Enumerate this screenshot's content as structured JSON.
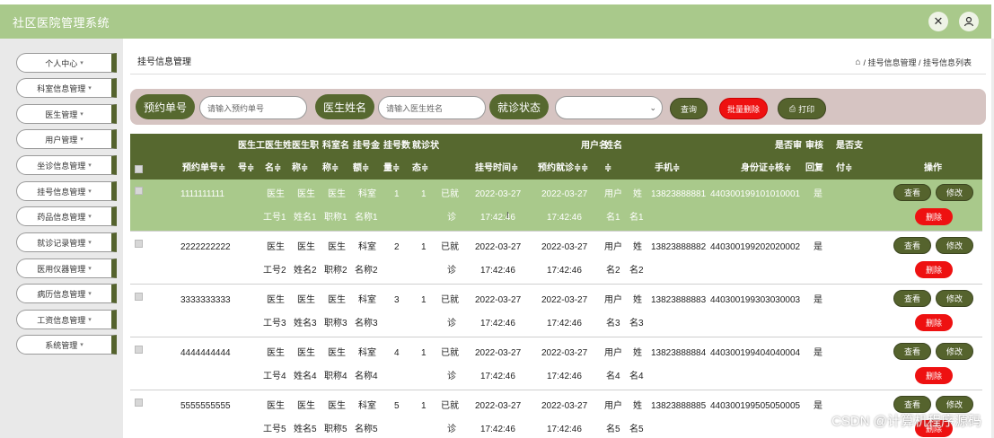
{
  "app": {
    "title": "社区医院管理系统"
  },
  "top_icons": [
    "fullscreen-icon",
    "user-icon"
  ],
  "sidebar": {
    "items": [
      {
        "label": "个人中心"
      },
      {
        "label": "科室信息管理"
      },
      {
        "label": "医生管理"
      },
      {
        "label": "用户管理"
      },
      {
        "label": "坐诊信息管理"
      },
      {
        "label": "挂号信息管理"
      },
      {
        "label": "药品信息管理"
      },
      {
        "label": "就诊记录管理"
      },
      {
        "label": "医用仪器管理"
      },
      {
        "label": "病历信息管理"
      },
      {
        "label": "工资信息管理"
      },
      {
        "label": "系统管理"
      }
    ]
  },
  "header": {
    "title": "挂号信息管理",
    "breadcrumb": "/ 挂号信息管理 / 挂号信息列表"
  },
  "search": {
    "reservation_label": "预约单号",
    "reservation_placeholder": "请输入预约单号",
    "doctor_label": "医生姓名",
    "doctor_placeholder": "请输入医生姓名",
    "status_label": "就诊状态",
    "status_value": "",
    "query_button": "查询",
    "batch_delete_button": "批量删除",
    "print_button": "打印"
  },
  "table": {
    "columns": [
      {
        "l1": "",
        "l2": "预约单号≑"
      },
      {
        "l1": "医生工",
        "l2": "号≑"
      },
      {
        "l1": "医生姓",
        "l2": "名≑"
      },
      {
        "l1": "医生职",
        "l2": "称≑"
      },
      {
        "l1": "科室名",
        "l2": "称≑"
      },
      {
        "l1": "挂号金",
        "l2": "额≑"
      },
      {
        "l1": "挂号数",
        "l2": "量≑"
      },
      {
        "l1": "就诊状",
        "l2": "态≑"
      },
      {
        "l1": "",
        "l2": "挂号时间≑"
      },
      {
        "l1": "",
        "l2": "预约就诊≑"
      },
      {
        "l1": "用户名",
        "l2": "≑"
      },
      {
        "l1": "姓名",
        "l2": "≑"
      },
      {
        "l1": "",
        "l2": "手机≑"
      },
      {
        "l1": "",
        "l2": "身份证≑"
      },
      {
        "l1": "是否审",
        "l2": "核≑"
      },
      {
        "l1": "审核",
        "l2": "回复"
      },
      {
        "l1": "是否支",
        "l2": "付≑"
      },
      {
        "l1": "",
        "l2": "操作"
      }
    ],
    "actions": {
      "view": "查看",
      "edit": "修改",
      "delete": "删除"
    },
    "rows": [
      {
        "id": "1111111111",
        "doc_no": [
          "医生",
          "工号1"
        ],
        "doc_name": [
          "医生",
          "姓名1"
        ],
        "title": [
          "医生",
          "职称1"
        ],
        "dept": [
          "科室",
          "名称1"
        ],
        "amount": "1",
        "count": "1",
        "status": [
          "已就",
          "诊"
        ],
        "reg_time": [
          "2022-03-27",
          "17:42:46"
        ],
        "appt_time": [
          "2022-03-27",
          "17:42:46"
        ],
        "username": [
          "用户",
          "名1"
        ],
        "name": [
          "姓",
          "名1"
        ],
        "phone": "13823888881",
        "idcard": "440300199101010001",
        "reviewed": "是",
        "reply": "",
        "paid": ""
      },
      {
        "id": "2222222222",
        "doc_no": [
          "医生",
          "工号2"
        ],
        "doc_name": [
          "医生",
          "姓名2"
        ],
        "title": [
          "医生",
          "职称2"
        ],
        "dept": [
          "科室",
          "名称2"
        ],
        "amount": "2",
        "count": "1",
        "status": [
          "已就",
          "诊"
        ],
        "reg_time": [
          "2022-03-27",
          "17:42:46"
        ],
        "appt_time": [
          "2022-03-27",
          "17:42:46"
        ],
        "username": [
          "用户",
          "名2"
        ],
        "name": [
          "姓",
          "名2"
        ],
        "phone": "13823888882",
        "idcard": "440300199202020002",
        "reviewed": "是",
        "reply": "",
        "paid": ""
      },
      {
        "id": "3333333333",
        "doc_no": [
          "医生",
          "工号3"
        ],
        "doc_name": [
          "医生",
          "姓名3"
        ],
        "title": [
          "医生",
          "职称3"
        ],
        "dept": [
          "科室",
          "名称3"
        ],
        "amount": "3",
        "count": "1",
        "status": [
          "已就",
          "诊"
        ],
        "reg_time": [
          "2022-03-27",
          "17:42:46"
        ],
        "appt_time": [
          "2022-03-27",
          "17:42:46"
        ],
        "username": [
          "用户",
          "名3"
        ],
        "name": [
          "姓",
          "名3"
        ],
        "phone": "13823888883",
        "idcard": "440300199303030003",
        "reviewed": "是",
        "reply": "",
        "paid": ""
      },
      {
        "id": "4444444444",
        "doc_no": [
          "医生",
          "工号4"
        ],
        "doc_name": [
          "医生",
          "姓名4"
        ],
        "title": [
          "医生",
          "职称4"
        ],
        "dept": [
          "科室",
          "名称4"
        ],
        "amount": "4",
        "count": "1",
        "status": [
          "已就",
          "诊"
        ],
        "reg_time": [
          "2022-03-27",
          "17:42:46"
        ],
        "appt_time": [
          "2022-03-27",
          "17:42:46"
        ],
        "username": [
          "用户",
          "名4"
        ],
        "name": [
          "姓",
          "名4"
        ],
        "phone": "13823888884",
        "idcard": "440300199404040004",
        "reviewed": "是",
        "reply": "",
        "paid": ""
      },
      {
        "id": "5555555555",
        "doc_no": [
          "医生",
          "工号5"
        ],
        "doc_name": [
          "医生",
          "姓名5"
        ],
        "title": [
          "医生",
          "职称5"
        ],
        "dept": [
          "科室",
          "名称5"
        ],
        "amount": "5",
        "count": "1",
        "status": [
          "已就",
          "诊"
        ],
        "reg_time": [
          "2022-03-27",
          "17:42:46"
        ],
        "appt_time": [
          "2022-03-27",
          "17:42:46"
        ],
        "username": [
          "用户",
          "名5"
        ],
        "name": [
          "姓",
          "名5"
        ],
        "phone": "13823888885",
        "idcard": "440300199505050005",
        "reviewed": "是",
        "reply": "",
        "paid": ""
      }
    ]
  },
  "watermark": "CSDN @计算机程序源码",
  "colors": {
    "topbar": "#a9c98b",
    "header": "#56682f",
    "accent_red": "#ee1111",
    "search_bg": "#d6c4c2"
  }
}
